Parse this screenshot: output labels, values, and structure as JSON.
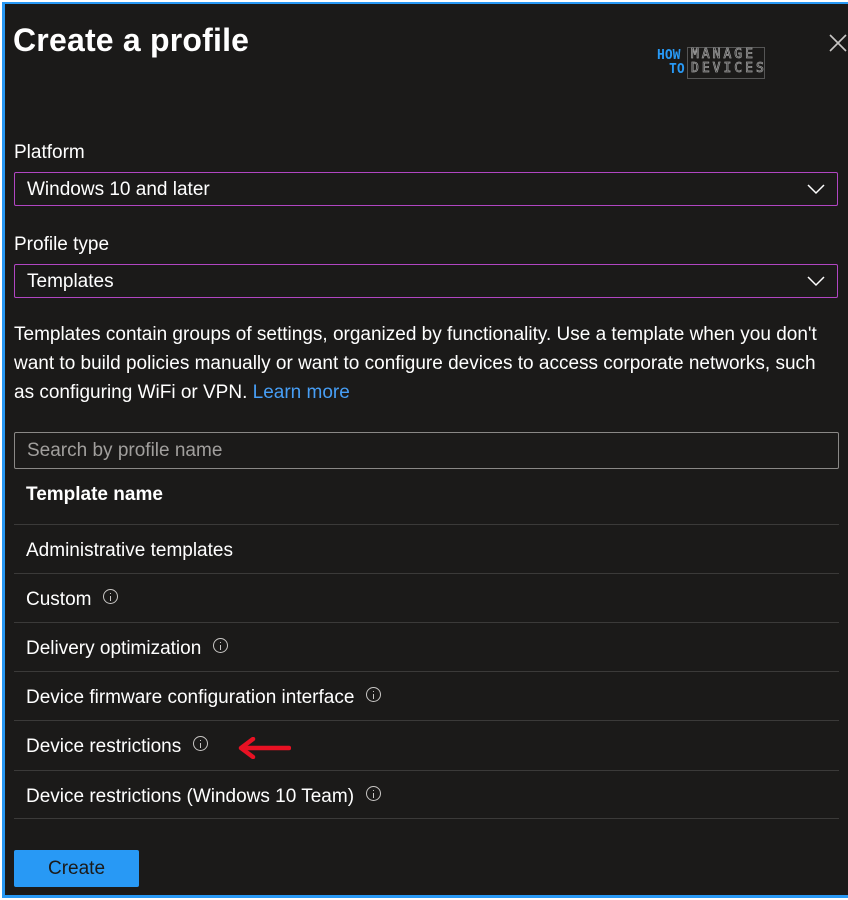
{
  "title": "Create a profile",
  "logo": {
    "line1": "HOW",
    "line2": "TO",
    "box_line1": "MANAGE",
    "box_line2": "DEVICES"
  },
  "platform": {
    "label": "Platform",
    "value": "Windows 10 and later"
  },
  "profile_type": {
    "label": "Profile type",
    "value": "Templates"
  },
  "description": {
    "text": "Templates contain groups of settings, organized by functionality. Use a template when you don't want to build policies manually or want to configure devices to access corporate networks, such as configuring WiFi or VPN.",
    "link": "Learn more"
  },
  "search": {
    "placeholder": "Search by profile name"
  },
  "table": {
    "header": "Template name",
    "rows": [
      {
        "name": "Administrative templates",
        "info": false
      },
      {
        "name": "Custom",
        "info": true
      },
      {
        "name": "Delivery optimization",
        "info": true
      },
      {
        "name": "Device firmware configuration interface",
        "info": true
      },
      {
        "name": "Device restrictions",
        "info": true,
        "highlighted": true
      },
      {
        "name": "Device restrictions (Windows 10 Team)",
        "info": true
      }
    ]
  },
  "create_button": "Create",
  "colors": {
    "accent": "#2899f5",
    "select_border": "#b146c2",
    "background": "#1b1a19",
    "arrow": "#e81123",
    "link": "#479ef5"
  },
  "icons": {
    "close": "close-icon",
    "chevron": "chevron-down-icon",
    "info": "info-icon",
    "arrow": "arrow-left-icon"
  }
}
